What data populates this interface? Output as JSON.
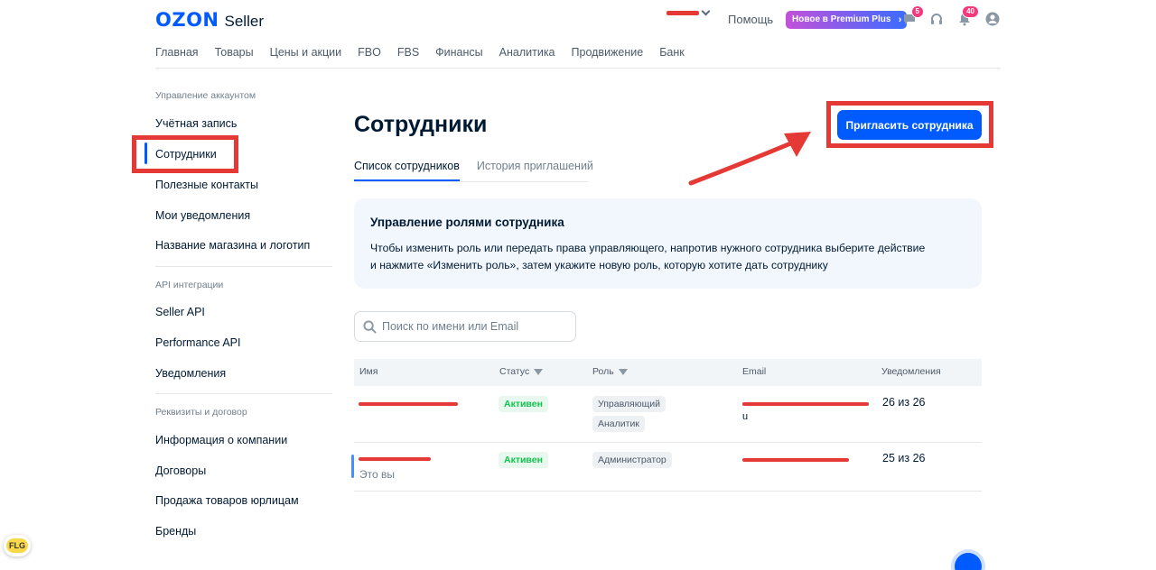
{
  "header": {
    "logo_brand": "OZON",
    "logo_product": "Seller",
    "help": "Помощь",
    "premium": "Новое в Premium Plus",
    "chat_badge": "5",
    "notif_badge": "40"
  },
  "nav": [
    "Главная",
    "Товары",
    "Цены и акции",
    "FBO",
    "FBS",
    "Финансы",
    "Аналитика",
    "Продвижение",
    "Банк"
  ],
  "sidebar": {
    "sections": [
      {
        "title": "Управление аккаунтом",
        "items": [
          "Учётная запись",
          "Сотрудники",
          "Полезные контакты",
          "Мои уведомления",
          "Название магазина и логотип"
        ]
      },
      {
        "title": "API интеграции",
        "items": [
          "Seller API",
          "Performance API",
          "Уведомления"
        ]
      },
      {
        "title": "Реквизиты и договор",
        "items": [
          "Информация о компании",
          "Договоры",
          "Продажа товаров юрлицам",
          "Бренды"
        ]
      }
    ],
    "active": "Сотрудники"
  },
  "main": {
    "title": "Сотрудники",
    "invite_button": "Пригласить сотрудника",
    "tabs": [
      "Список сотрудников",
      "История приглашений"
    ],
    "info_title": "Управление ролями сотрудника",
    "info_line1": "Чтобы изменить роль или передать права управляющего, напротив нужного сотрудника выберите действие",
    "info_line2": "и нажмите «Изменить роль», затем укажите новую роль, которую хотите дать сотруднику",
    "search_placeholder": "Поиск по имени или Email",
    "table": {
      "headers": [
        "Имя",
        "Статус",
        "Роль",
        "Email",
        "Уведомления"
      ],
      "rows": [
        {
          "status": "Активен",
          "roles": [
            "Управляющий",
            "Аналитик"
          ],
          "email_tail": "u",
          "notifications": "26 из 26"
        },
        {
          "status": "Активен",
          "roles": [
            "Администратор"
          ],
          "you": "Это вы",
          "notifications": "25 из 26"
        }
      ]
    }
  },
  "flg": "FLG",
  "colors": {
    "accent": "#005bff",
    "annotation": "#e53935",
    "status_active": "#10c44c"
  }
}
